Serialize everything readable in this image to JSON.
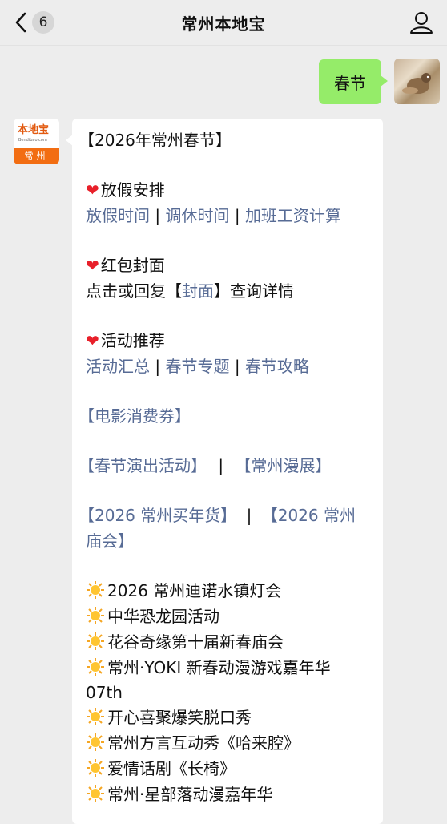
{
  "header": {
    "title": "常州本地宝",
    "unread_count": "6"
  },
  "outgoing": {
    "text": "春节"
  },
  "incoming": {
    "avatar": {
      "name": "本地宝",
      "site": "Bendibao.com",
      "city": "常州"
    },
    "heading": "【2026年常州春节】",
    "sections": {
      "holiday": {
        "title": "放假安排",
        "links": [
          "放假时间",
          "调休时间",
          "加班工资计算"
        ],
        "sep": "|"
      },
      "red_packet": {
        "title": "红包封面",
        "pre": "点击或回复【",
        "link": "封面",
        "post": "】查询详情"
      },
      "activities": {
        "title": "活动推荐",
        "links": [
          "活动汇总",
          "春节专题",
          "春节攻略"
        ],
        "sep": "|"
      }
    },
    "bracket_links": {
      "movie": "【电影消费券】",
      "show": "【春节演出活动】",
      "sep": "|",
      "comic": "【常州漫展】",
      "newyear": "【2026 常州买年货】",
      "fair_a": "【2026 常州",
      "fair_b": "庙会】"
    },
    "sun_items": [
      "2026 常州迪诺水镇灯会",
      "中华恐龙园活动",
      "花谷奇缘第十届新春庙会",
      "常州·YOKI 新春动漫游戏嘉年华",
      "开心喜聚爆笑脱口秀",
      "常州方言互动秀《哈来腔》",
      "爱情话剧《长椅》",
      "常州·星部落动漫嘉年华"
    ],
    "sun_item_cont": "07th"
  },
  "colors": {
    "link": "#576b95",
    "bubble_out": "#95ec69",
    "heart": "#e8202a",
    "sun": "#f5a623"
  }
}
